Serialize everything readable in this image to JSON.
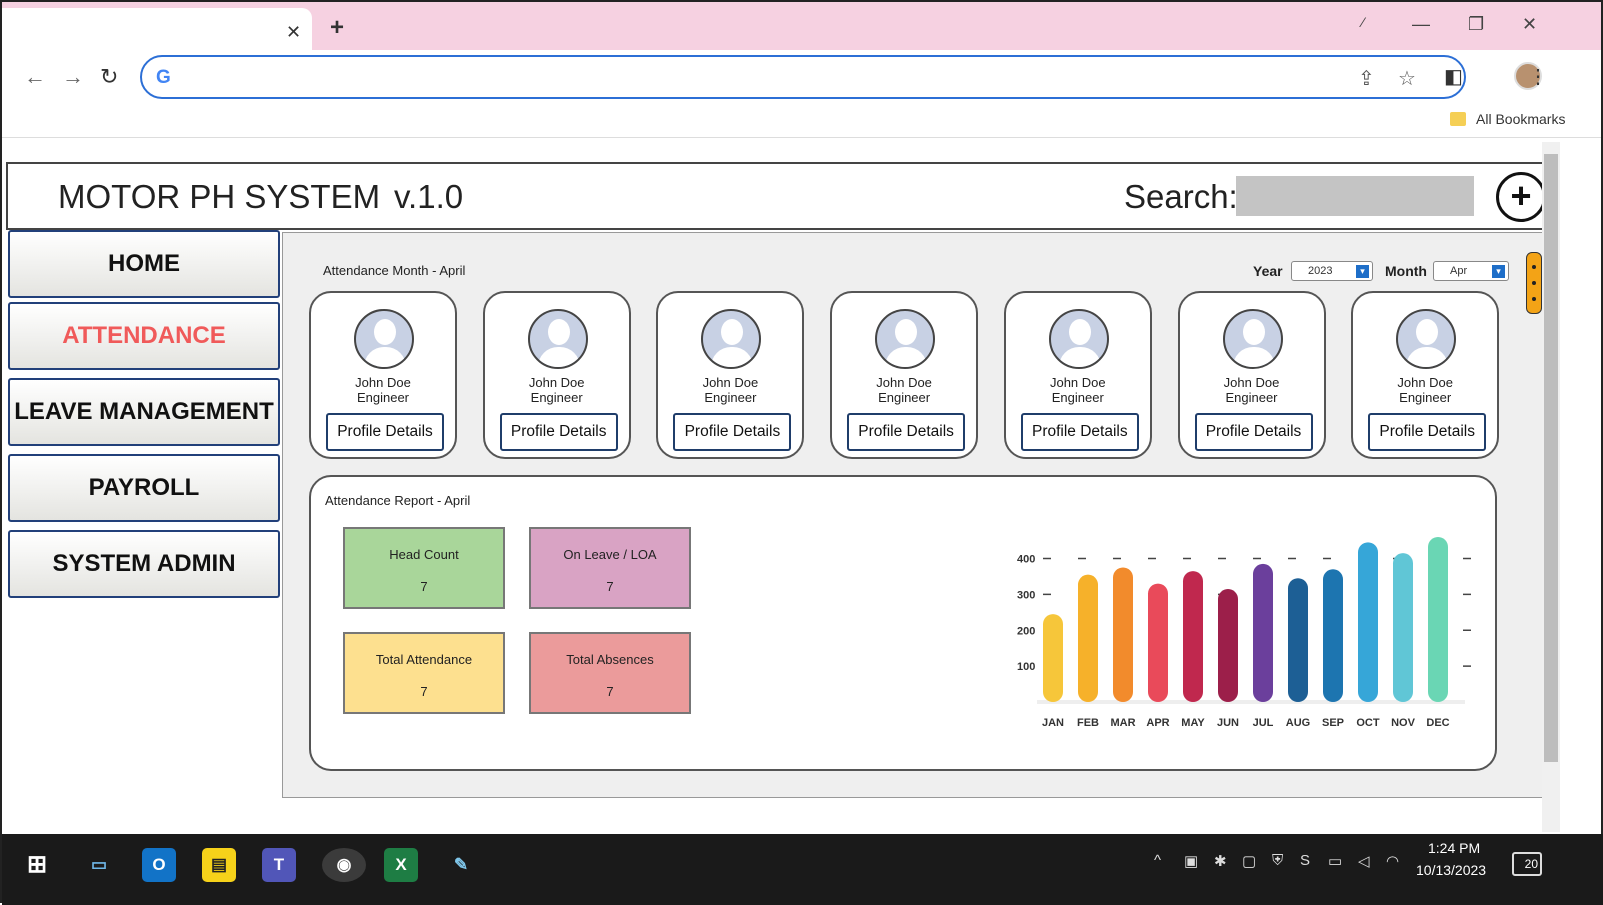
{
  "browser": {
    "tab_close": "✕",
    "new_tab": "+",
    "bookmarks_label": "All Bookmarks"
  },
  "app": {
    "title": "MOTOR PH SYSTEM",
    "version": "v.1.0",
    "search_label": "Search:",
    "search_value": "",
    "add_label": "+"
  },
  "menu": [
    {
      "label": "HOME",
      "active": false
    },
    {
      "label": "ATTENDANCE",
      "active": true
    },
    {
      "label": "LEAVE MANAGEMENT",
      "active": false
    },
    {
      "label": "PAYROLL",
      "active": false
    },
    {
      "label": "SYSTEM ADMIN",
      "active": false
    }
  ],
  "attendance": {
    "section_title": "Attendance Month - April",
    "year_label": "Year",
    "year_value": "2023",
    "month_label": "Month",
    "month_value": "Apr"
  },
  "employees": [
    {
      "name": "John Doe",
      "role": "Engineer",
      "button": "Profile Details"
    },
    {
      "name": "John Doe",
      "role": "Engineer",
      "button": "Profile Details"
    },
    {
      "name": "John Doe",
      "role": "Engineer",
      "button": "Profile Details"
    },
    {
      "name": "John Doe",
      "role": "Engineer",
      "button": "Profile Details"
    },
    {
      "name": "John Doe",
      "role": "Engineer",
      "button": "Profile Details"
    },
    {
      "name": "John Doe",
      "role": "Engineer",
      "button": "Profile Details"
    },
    {
      "name": "John Doe",
      "role": "Engineer",
      "button": "Profile Details"
    }
  ],
  "report": {
    "title": "Attendance Report - April",
    "stats": [
      {
        "label": "Head Count",
        "value": "7",
        "color": "#a9d69a"
      },
      {
        "label": "On Leave / LOA",
        "value": "7",
        "color": "#d9a3c4"
      },
      {
        "label": "Total Attendance",
        "value": "7",
        "color": "#fde08f"
      },
      {
        "label": "Total Absences",
        "value": "7",
        "color": "#eb9b9b"
      }
    ]
  },
  "chart_data": {
    "type": "bar",
    "categories": [
      "JAN",
      "FEB",
      "MAR",
      "APR",
      "MAY",
      "JUN",
      "JUL",
      "AUG",
      "SEP",
      "OCT",
      "NOV",
      "DEC"
    ],
    "values": [
      245,
      355,
      375,
      330,
      365,
      315,
      385,
      345,
      370,
      445,
      415,
      460
    ],
    "colors": [
      "#f6c63a",
      "#f6b12a",
      "#f28b2c",
      "#e94a5a",
      "#c0284e",
      "#9c1f4a",
      "#6b3f9c",
      "#1d5f95",
      "#1d75b0",
      "#36a6d8",
      "#60c6d6",
      "#6ad6b4"
    ],
    "yticks": [
      100,
      200,
      300,
      400
    ],
    "ylim": [
      0,
      460
    ],
    "grid": "dashed"
  },
  "taskbar": {
    "time": "1:24 PM",
    "date": "10/13/2023",
    "notifications": "20"
  }
}
